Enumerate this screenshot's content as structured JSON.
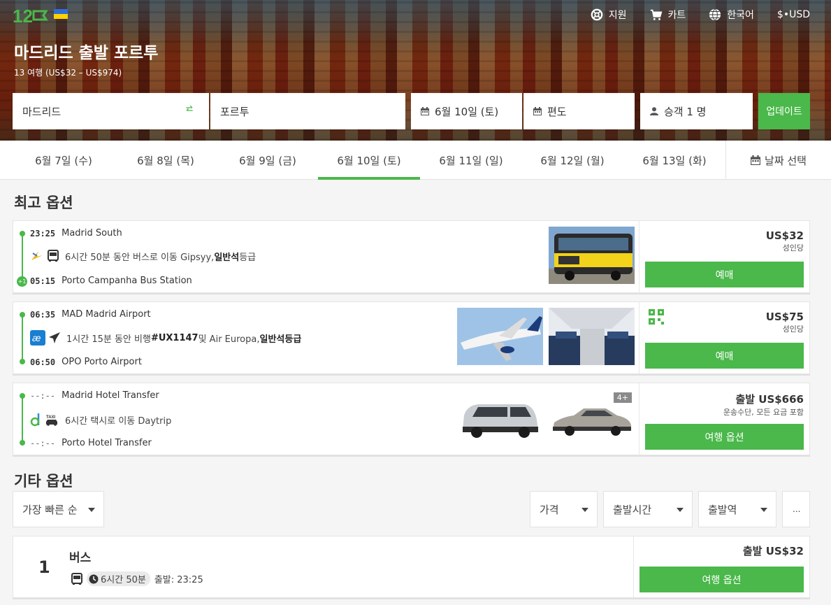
{
  "brand": {
    "logo_text": "12GO",
    "accent": "#4ab84a"
  },
  "topnav": [
    {
      "label": "지원",
      "icon": "lifebuoy-icon"
    },
    {
      "label": "카트",
      "icon": "cart-icon"
    },
    {
      "label": "한국어",
      "icon": "globe-icon"
    },
    {
      "label": "$•USD",
      "icon": ""
    }
  ],
  "header": {
    "title": "마드리드 출발 포르투",
    "subtitle": "13 여행 (US$32 – US$974)"
  },
  "search": {
    "from": "마드리드",
    "to": "포르투",
    "date": "6월 10일 (토)",
    "return": "편도",
    "passengers": "승객 1 명",
    "update_label": "업데이트"
  },
  "dates": [
    {
      "label": "6월 7일 (수)",
      "active": false
    },
    {
      "label": "6월 8일 (목)",
      "active": false
    },
    {
      "label": "6월 9일 (금)",
      "active": false
    },
    {
      "label": "6월 10일 (토)",
      "active": true
    },
    {
      "label": "6월 11일 (일)",
      "active": false
    },
    {
      "label": "6월 12일 (월)",
      "active": false
    },
    {
      "label": "6월 13일 (화)",
      "active": false
    }
  ],
  "date_picker_label": "날짜 선택",
  "best_title": "최고 옵션",
  "best": [
    {
      "dep_time": "23:25",
      "dep_place": "Madrid South",
      "mid_pre": "6시간 50분 동안 버스로 이동 Gipsyy, ",
      "mid_bold": "일반석",
      "mid_post": " 등급",
      "arr_badge": "+1",
      "arr_time": "05:15",
      "arr_place": "Porto Campanha Bus Station",
      "price": "US$32",
      "per": "성인당",
      "button": "예매"
    },
    {
      "dep_time": "06:35",
      "dep_place": "MAD Madrid Airport",
      "mid_pre": "1시간 15분 동안 비행 ",
      "mid_bold": "#UX1147",
      "mid_post": " 및 Air Europa, ",
      "mid_bold2": "일반석등급",
      "arr_time": "06:50",
      "arr_place": "OPO Porto Airport",
      "price": "US$75",
      "per": "성인당",
      "button": "예매"
    },
    {
      "dep_time": "--:--",
      "dep_place": "Madrid Hotel Transfer",
      "mid_pre": "6시간 택시로 이동 Daytrip",
      "arr_time": "--:--",
      "arr_place": "Porto Hotel Transfer",
      "photo_badge": "4+",
      "price": "출발 US$666",
      "per": "운송수단, 모든 요금 포함",
      "button": "여행 옵션"
    }
  ],
  "other_title": "기타 옵션",
  "filters": {
    "sort": "가장 빠른 순",
    "price": "가격",
    "departure": "출발시간",
    "station": "출발역",
    "more": "..."
  },
  "result": {
    "rank": "1",
    "type": "버스",
    "duration": "6시간 50분",
    "departure": "출발: 23:25",
    "price": "출발 US$32",
    "button": "여행 옵션"
  }
}
